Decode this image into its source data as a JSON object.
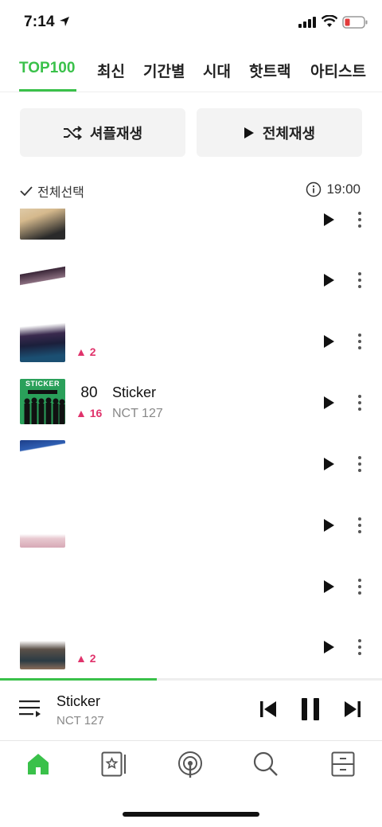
{
  "status_bar": {
    "time": "7:14"
  },
  "tabs": [
    {
      "label": "TOP100"
    },
    {
      "label": "최신"
    },
    {
      "label": "기간별"
    },
    {
      "label": "시대"
    },
    {
      "label": "핫트랙"
    },
    {
      "label": "아티스트"
    }
  ],
  "actions": {
    "shuffle_label": "셔플재생",
    "play_all_label": "전체재생"
  },
  "select_all_label": "전체선택",
  "chart_time": "19:00",
  "chart_rows": [
    {
      "rank": "",
      "change": "",
      "title": "",
      "artist": ""
    },
    {
      "rank": "",
      "change": "",
      "title": "",
      "artist": ""
    },
    {
      "rank": "",
      "change": "▲ 2",
      "title": "",
      "artist": ""
    },
    {
      "rank": "80",
      "change": "▲ 16",
      "title": "Sticker",
      "artist": "NCT 127"
    },
    {
      "rank": "",
      "change": "",
      "title": "",
      "artist": ""
    },
    {
      "rank": "",
      "change": "",
      "title": "",
      "artist": ""
    },
    {
      "rank": "",
      "change": "",
      "title": "",
      "artist": ""
    },
    {
      "rank": "",
      "change": "▲ 2",
      "title": "",
      "artist": ""
    }
  ],
  "thumb_labels": {
    "sticker_text": "STICKER"
  },
  "now_playing": {
    "title": "Sticker",
    "artist": "NCT 127",
    "progress": 0.41
  },
  "colors": {
    "accent": "#3ac14a",
    "rank_up": "#e0336b"
  }
}
